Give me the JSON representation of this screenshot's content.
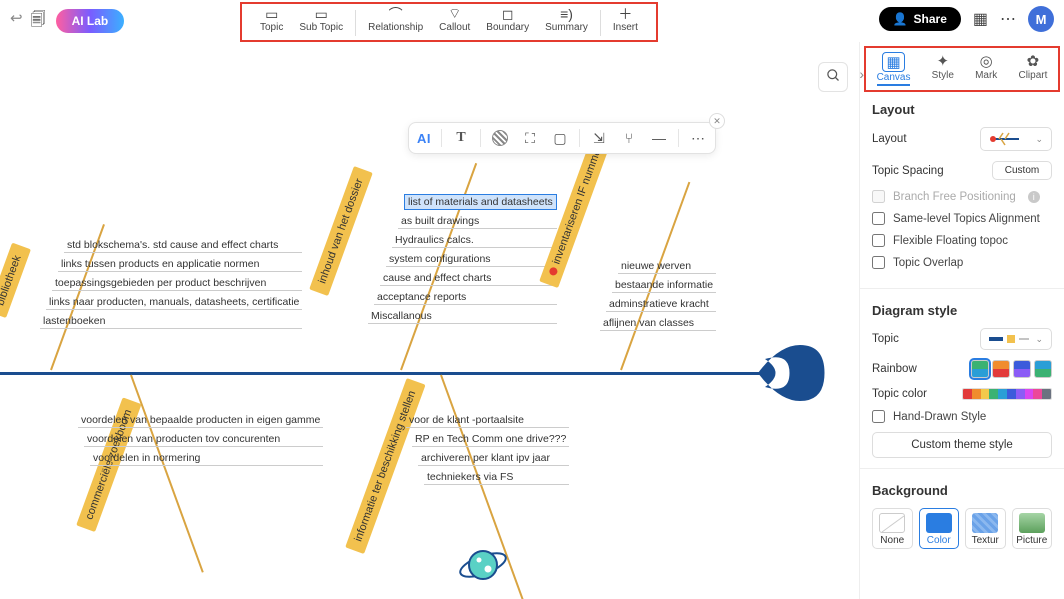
{
  "top": {
    "ai_lab": "AI Lab",
    "share": "Share",
    "avatar": "M"
  },
  "toolbar": [
    {
      "id": "topic",
      "label": "Topic"
    },
    {
      "id": "subtopic",
      "label": "Sub Topic"
    },
    {
      "sep": true
    },
    {
      "id": "relationship",
      "label": "Relationship"
    },
    {
      "id": "callout",
      "label": "Callout"
    },
    {
      "id": "boundary",
      "label": "Boundary"
    },
    {
      "id": "summary",
      "label": "Summary"
    },
    {
      "sep": true
    },
    {
      "id": "insert",
      "label": "Insert"
    }
  ],
  "floating": [
    "AI",
    "T",
    "hatch",
    "crop",
    "rect",
    "share",
    "branch",
    "line",
    "more"
  ],
  "panel": {
    "tabs": [
      {
        "id": "canvas",
        "label": "Canvas",
        "active": true
      },
      {
        "id": "style",
        "label": "Style"
      },
      {
        "id": "mark",
        "label": "Mark"
      },
      {
        "id": "clipart",
        "label": "Clipart"
      }
    ],
    "layout": {
      "title": "Layout",
      "layout_label": "Layout",
      "spacing_label": "Topic Spacing",
      "spacing_value": "Custom",
      "branch_free": "Branch Free Positioning",
      "same_level": "Same-level Topics Alignment",
      "flexible": "Flexible Floating topoc",
      "overlap": "Topic Overlap"
    },
    "diagram": {
      "title": "Diagram style",
      "topic": "Topic",
      "rainbow": "Rainbow",
      "topic_color": "Topic color",
      "hand_drawn": "Hand-Drawn Style",
      "custom_theme": "Custom theme style"
    },
    "background": {
      "title": "Background",
      "opts": [
        "None",
        "Color",
        "Textur",
        "Picture"
      ]
    }
  },
  "rainbow_colors": [
    "#e23b3b",
    "#f08c2e",
    "#f2c94c",
    "#3bb273",
    "#2a9ed6",
    "#3b5bdb",
    "#8b5cf6",
    "#d946ef",
    "#ec4899",
    "#6b7280"
  ],
  "chart_data": {
    "type": "fishbone",
    "title": "",
    "bones": [
      {
        "id": "bibliotheek",
        "label": "bibliotheek",
        "side": "upper",
        "subs": [
          "std blokschema's. std cause and effect charts",
          "links tussen products en applicatie normen",
          "toepassingsgebieden per product beschrijven",
          "links naar producten, manuals, datasheets, certificatie",
          "lastenboeken"
        ]
      },
      {
        "id": "inhoud",
        "label": "inhoud van het dossier",
        "side": "upper",
        "subs": [
          "list of materials and datasheets",
          "as built drawings",
          "Hydraulics calcs.",
          "system configurations",
          "cause and effect charts",
          "acceptance reports",
          "Miscallanous"
        ],
        "selected_index": 0
      },
      {
        "id": "inventariseren",
        "label": "inventariseren IF nummer",
        "side": "upper",
        "marker": true,
        "subs": [
          "nieuwe werven",
          "bestaande informatie",
          "adminstratieve kracht",
          "aflijnen van classes"
        ]
      },
      {
        "id": "commerciele",
        "label": "commerciële zoekboom",
        "side": "lower",
        "subs": [
          "voordelen van bepaalde producten in eigen gamme",
          "voordelen van producten tov concurenten",
          "voordelen in normering"
        ]
      },
      {
        "id": "informatie",
        "label": "informatie ter beschikking stellen",
        "side": "lower",
        "subs": [
          "voor de klant -portaalsite",
          "RP en Tech Comm one drive???",
          "archiveren per klant ipv jaar",
          "techniekers via FS"
        ]
      }
    ]
  }
}
